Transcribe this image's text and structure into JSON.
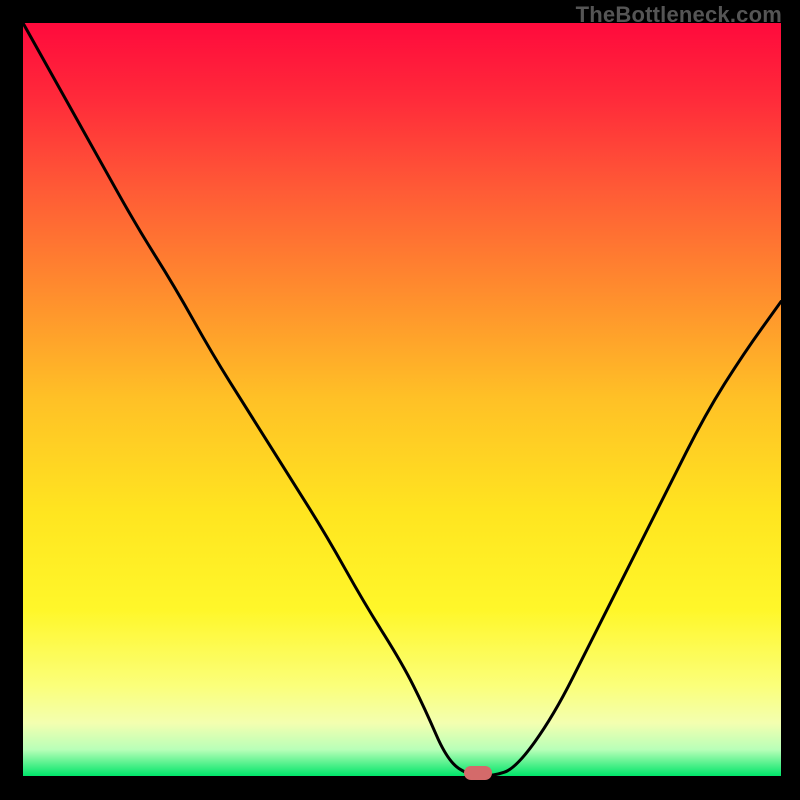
{
  "watermark": "TheBottleneck.com",
  "colors": {
    "background": "#000000",
    "curve": "#000000",
    "marker": "#d46a6a",
    "gradient_stops": [
      {
        "offset": 0.0,
        "color": "#ff0a3c"
      },
      {
        "offset": 0.1,
        "color": "#ff2a3a"
      },
      {
        "offset": 0.22,
        "color": "#ff5a36"
      },
      {
        "offset": 0.35,
        "color": "#ff8a2e"
      },
      {
        "offset": 0.5,
        "color": "#ffc126"
      },
      {
        "offset": 0.65,
        "color": "#ffe520"
      },
      {
        "offset": 0.78,
        "color": "#fff72a"
      },
      {
        "offset": 0.88,
        "color": "#fbff7a"
      },
      {
        "offset": 0.93,
        "color": "#f3ffb0"
      },
      {
        "offset": 0.965,
        "color": "#b8ffb8"
      },
      {
        "offset": 0.985,
        "color": "#4ef08a"
      },
      {
        "offset": 1.0,
        "color": "#00e56a"
      }
    ]
  },
  "chart_data": {
    "type": "line",
    "title": "",
    "xlabel": "",
    "ylabel": "",
    "xlim": [
      0,
      100
    ],
    "ylim": [
      0,
      100
    ],
    "x": [
      0,
      5,
      10,
      15,
      20,
      25,
      30,
      35,
      40,
      45,
      50,
      53,
      56,
      59,
      62,
      65,
      70,
      75,
      80,
      85,
      90,
      95,
      100
    ],
    "values": [
      100,
      91,
      82,
      73,
      65,
      56,
      48,
      40,
      32,
      23,
      15,
      9,
      2,
      0,
      0,
      1,
      8,
      18,
      28,
      38,
      48,
      56,
      63
    ],
    "marker": {
      "x": 60,
      "y": 0
    }
  }
}
